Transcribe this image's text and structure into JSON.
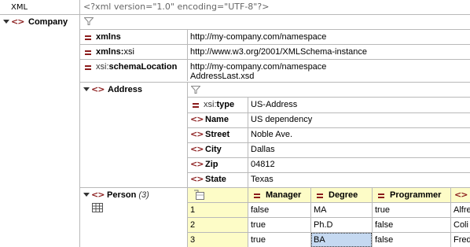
{
  "header": {
    "label": "XML",
    "declaration": "<?xml version=\"1.0\" encoding=\"UTF-8\"?>"
  },
  "root": {
    "name": "Company"
  },
  "attributes": [
    {
      "prefix": "",
      "local": "xmlns",
      "value": "http://my-company.com/namespace",
      "value2": ""
    },
    {
      "prefix": "xmlns:",
      "local": "xsi",
      "value": "http://www.w3.org/2001/XMLSchema-instance",
      "value2": ""
    },
    {
      "prefix": "xsi:",
      "local": "schemaLocation",
      "value": "http://my-company.com/namespace",
      "value2": "AddressLast.xsd"
    }
  ],
  "address": {
    "name": "Address",
    "type_attr": {
      "prefix": "xsi:",
      "local": "type",
      "value": "US-Address"
    },
    "children": [
      {
        "name": "Name",
        "value": "US dependency"
      },
      {
        "name": "Street",
        "value": "Noble Ave."
      },
      {
        "name": "City",
        "value": "Dallas"
      },
      {
        "name": "Zip",
        "value": "04812"
      },
      {
        "name": "State",
        "value": "Texas"
      }
    ]
  },
  "person": {
    "name": "Person",
    "count": "(3)",
    "columns": [
      "Manager",
      "Degree",
      "Programmer"
    ],
    "rows": [
      {
        "index": "1",
        "manager": "false",
        "degree": "MA",
        "programmer": "true",
        "extra": "Alfre"
      },
      {
        "index": "2",
        "manager": "true",
        "degree": "Ph.D",
        "programmer": "false",
        "extra": "Coli"
      },
      {
        "index": "3",
        "manager": "true",
        "degree": "BA",
        "programmer": "false",
        "extra": "Fred"
      }
    ]
  },
  "colors": {
    "element_icon": "#8b1c1c",
    "grid_line": "#b9b9b9",
    "table_header": "#fdfcc7",
    "selection": "#c5d9f1"
  }
}
